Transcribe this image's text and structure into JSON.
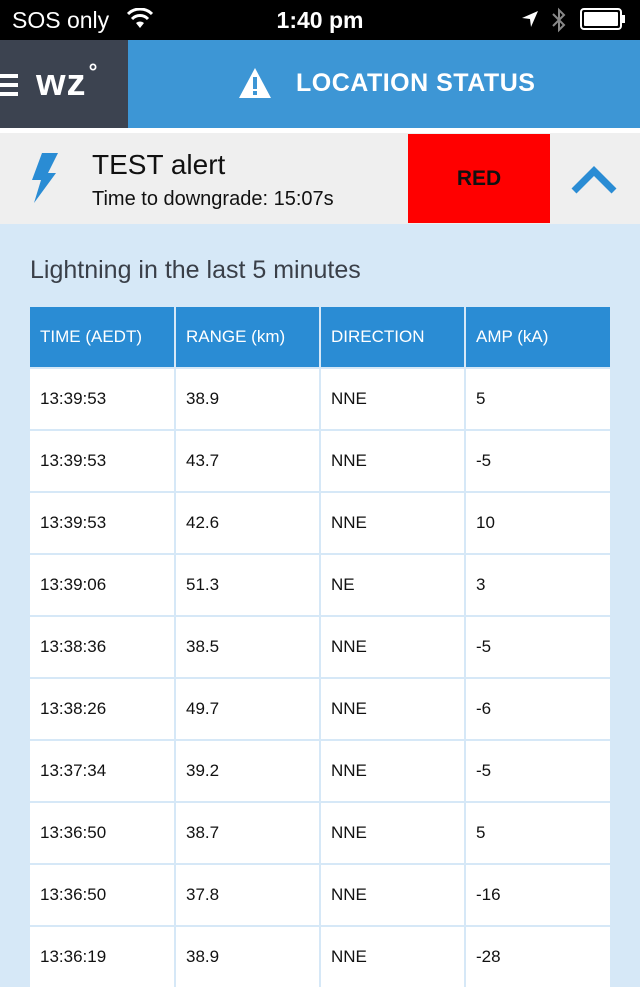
{
  "status_bar": {
    "carrier": "SOS only",
    "time": "1:40 pm"
  },
  "header": {
    "logo": "wz",
    "logo_mark": "°",
    "title": "LOCATION STATUS"
  },
  "alert": {
    "name": "TEST alert",
    "time_to_downgrade": "Time to downgrade: 15:07s",
    "level": "RED",
    "level_color": "#ff0000"
  },
  "section": {
    "title": "Lightning in the last 5 minutes"
  },
  "table": {
    "columns": [
      "TIME (AEDT)",
      "RANGE (km)",
      "DIRECTION",
      "AMP (kA)"
    ],
    "rows": [
      [
        "13:39:53",
        "38.9",
        "NNE",
        "5"
      ],
      [
        "13:39:53",
        "43.7",
        "NNE",
        "-5"
      ],
      [
        "13:39:53",
        "42.6",
        "NNE",
        "10"
      ],
      [
        "13:39:06",
        "51.3",
        "NE",
        "3"
      ],
      [
        "13:38:36",
        "38.5",
        "NNE",
        "-5"
      ],
      [
        "13:38:26",
        "49.7",
        "NNE",
        "-6"
      ],
      [
        "13:37:34",
        "39.2",
        "NNE",
        "-5"
      ],
      [
        "13:36:50",
        "38.7",
        "NNE",
        "5"
      ],
      [
        "13:36:50",
        "37.8",
        "NNE",
        "-16"
      ],
      [
        "13:36:19",
        "38.9",
        "NNE",
        "-28"
      ]
    ]
  },
  "colors": {
    "header_blue": "#3d96d5",
    "table_header": "#2a8cd4",
    "logo_bg": "#3c4350",
    "page_bg": "#d6e8f7"
  }
}
